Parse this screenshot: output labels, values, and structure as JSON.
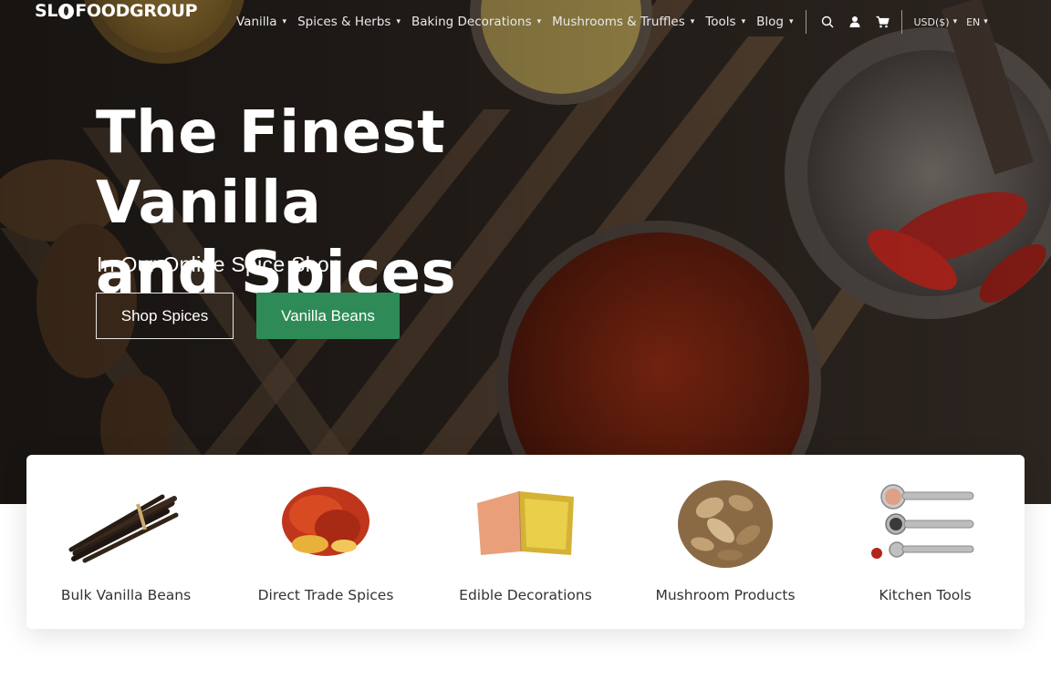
{
  "brand": {
    "logo_left": "SL",
    "logo_right": "FOODGROUP"
  },
  "nav": {
    "items": [
      {
        "label": "Vanilla"
      },
      {
        "label": "Spices & Herbs"
      },
      {
        "label": "Baking Decorations"
      },
      {
        "label": "Mushrooms & Truffles"
      },
      {
        "label": "Tools"
      },
      {
        "label": "Blog"
      }
    ],
    "caret": "▾",
    "currency": "USD($)",
    "language": "EN",
    "icons": [
      "search-icon",
      "user-icon",
      "cart-icon"
    ]
  },
  "hero": {
    "title_line1": "The Finest Vanilla",
    "title_line2": "and Spices",
    "subtitle": "In Our Online Spice Shop",
    "buttons": {
      "primary": "Shop Spices",
      "secondary": "Vanilla Beans"
    }
  },
  "categories": [
    {
      "label": "Bulk Vanilla Beans",
      "icon": "vanilla-beans-image"
    },
    {
      "label": "Direct Trade Spices",
      "icon": "saffron-image"
    },
    {
      "label": "Edible Decorations",
      "icon": "gold-leaf-image"
    },
    {
      "label": "Mushroom Products",
      "icon": "dried-mushrooms-image"
    },
    {
      "label": "Kitchen Tools",
      "icon": "measuring-spoons-image"
    }
  ],
  "colors": {
    "accent_green": "#2e8b57",
    "hero_dark": "#2a221c",
    "text_dark": "#333333"
  }
}
